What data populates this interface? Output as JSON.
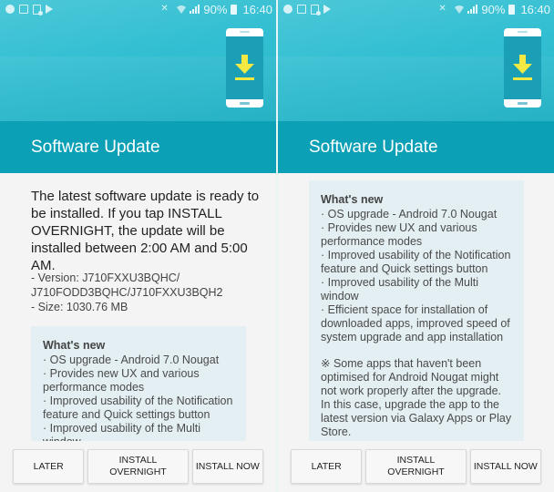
{
  "status_bar": {
    "notification_icons": [
      "messenger-icon",
      "gallery-icon",
      "file-settings-icon",
      "play-store-icon"
    ],
    "system_icons": [
      "mute-icon",
      "wifi-icon",
      "signal-icon"
    ],
    "battery": "90%",
    "time": "16:40"
  },
  "colors": {
    "hero": "#33bfd2",
    "title_bar": "#0ba0b6",
    "download_arrow": "#f4e842",
    "whats_new_bg": "#e3eff3"
  },
  "screens": [
    {
      "title": "Software Update",
      "intro": "The latest software update is ready to be installed. If you tap INSTALL OVERNIGHT, the update will be installed between 2:00 AM and 5:00 AM.",
      "version_line1": " - Version: J710FXXU3BQHC/",
      "version_line2": "J710FODD3BQHC/J710FXXU3BQH2",
      "size": " - Size: 1030.76 MB",
      "whats_new": {
        "title": "What's new",
        "items": [
          "· OS upgrade - Android 7.0 Nougat",
          "· Provides new UX and various performance modes",
          "· Improved usability of the Notification feature and Quick settings button",
          "· Improved usability of the Multi window"
        ]
      },
      "buttons": {
        "later": "LATER",
        "overnight": "INSTALL OVERNIGHT",
        "now": "INSTALL NOW"
      }
    },
    {
      "title": "Software Update",
      "whats_new": {
        "title": "What's new",
        "items": [
          "· OS upgrade - Android 7.0 Nougat",
          "· Provides new UX and various performance modes",
          "· Improved usability of the Notification feature and Quick settings button",
          "· Improved usability of the Multi window",
          "· Efficient space for installation of downloaded apps, improved speed of system upgrade and app installation"
        ],
        "note": "※ Some apps that haven't been optimised for Android Nougat might not work properly after the upgrade. In this case, upgrade the app to the latest version via Galaxy Apps or Play Store."
      },
      "buttons": {
        "later": "LATER",
        "overnight": "INSTALL OVERNIGHT",
        "now": "INSTALL NOW"
      }
    }
  ]
}
